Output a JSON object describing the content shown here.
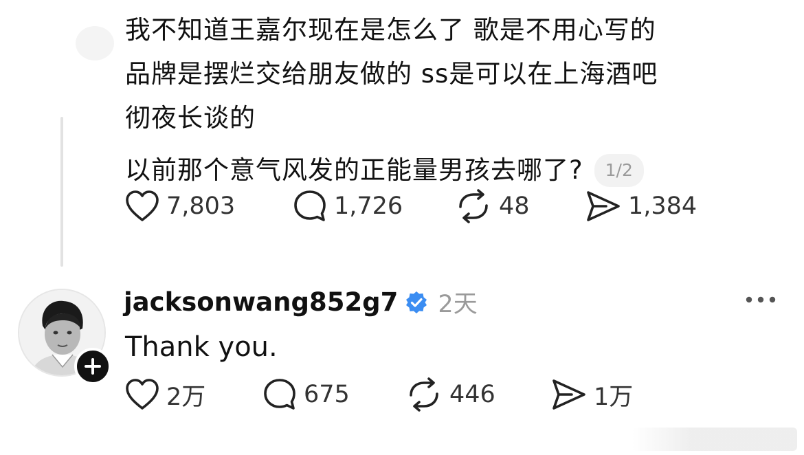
{
  "post": {
    "paragraphs": [
      "我不知道王嘉尔现在是怎么了 歌是不用心写的品牌是摆烂交给朋友做的 ss是可以在上海酒吧彻夜长谈的",
      "以前那个意气风发的正能量男孩去哪了?"
    ],
    "lines": [
      "我不知道王嘉尔现在是怎么了 歌是不用心写的",
      "品牌是摆烂交给朋友做的 ss是可以在上海酒吧",
      "彻夜长谈的"
    ],
    "page_indicator": "1/2",
    "actions": {
      "likes": "7,803",
      "comments": "1,726",
      "reposts": "48",
      "shares": "1,384"
    }
  },
  "reply": {
    "username": "jacksonwang852g7",
    "verified": true,
    "time": "2天",
    "text": "Thank you.",
    "actions": {
      "likes": "2万",
      "comments": "675",
      "reposts": "446",
      "shares": "1万"
    }
  },
  "icons": {
    "like": "heart-icon",
    "comment": "speech-bubble-icon",
    "repost": "repost-arrows-icon",
    "share": "send-icon",
    "more": "more-dots-icon",
    "follow": "plus-icon",
    "verified": "verified-badge-icon"
  },
  "colors": {
    "text": "#111111",
    "muted": "#9a9a9a",
    "verified": "#3b8df2"
  }
}
